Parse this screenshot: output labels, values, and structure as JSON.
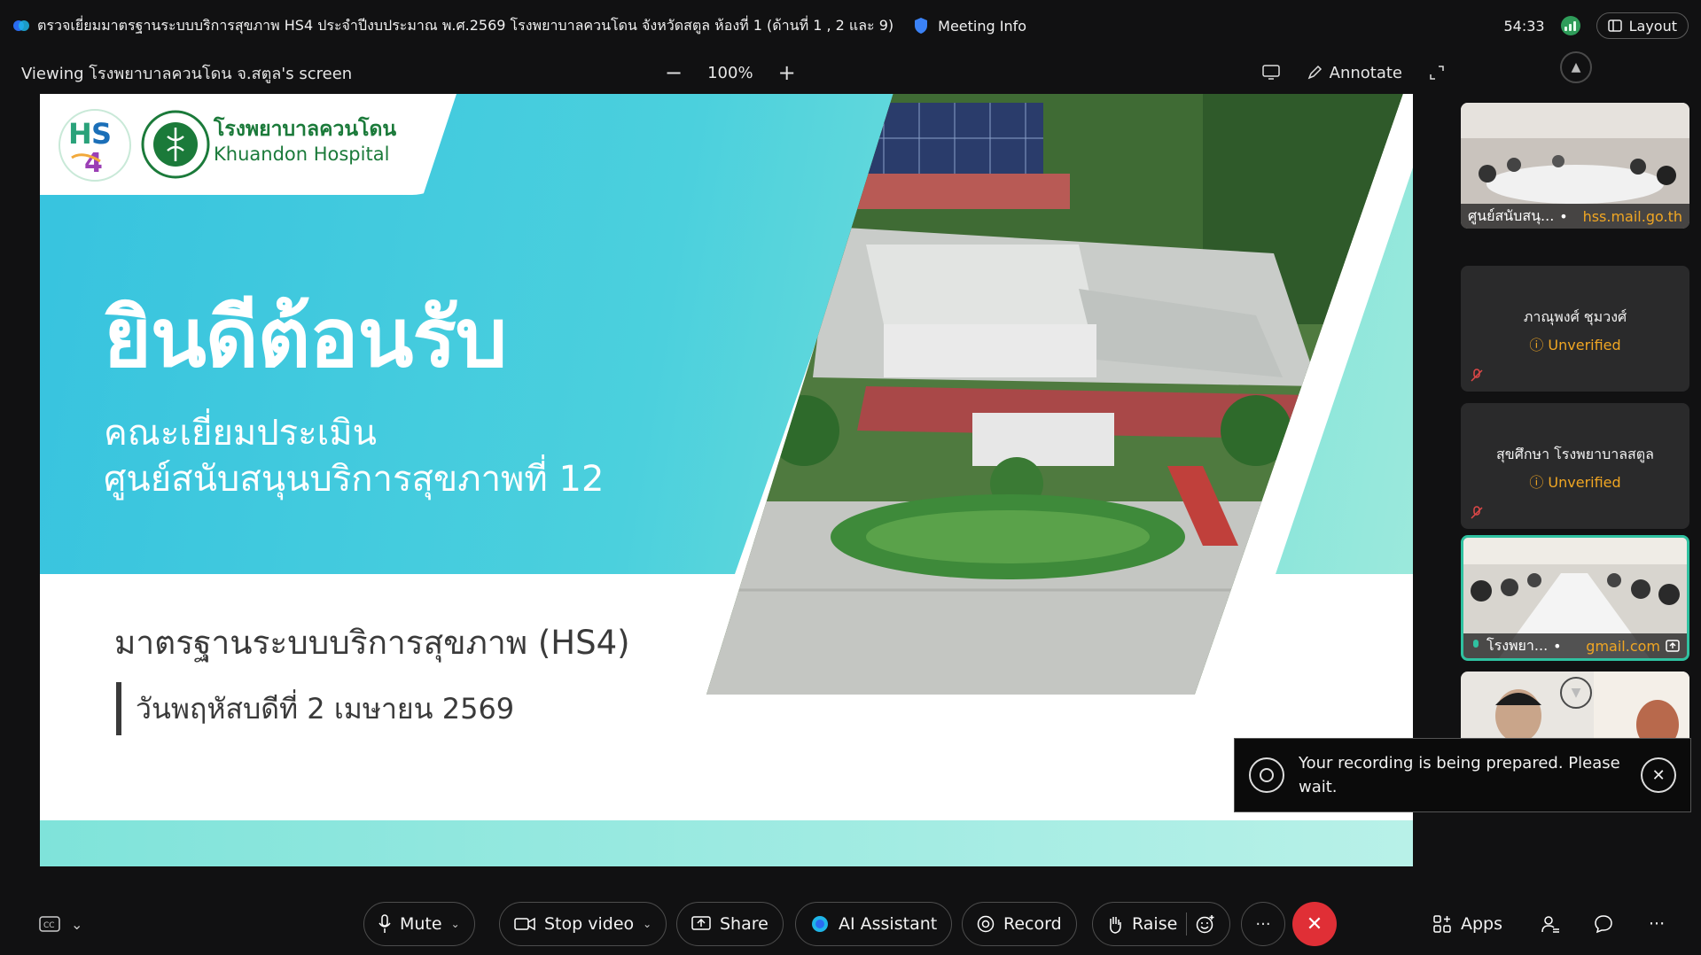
{
  "titlebar": {
    "meeting_title": "ตรวจเยี่ยมมาตรฐานระบบบริการสุขภาพ HS4 ประจำปีงบประมาณ พ.ศ.2569 โรงพยาบาลควนโดน จังหวัดสตูล  ห้องที่ 1 (ด้านที่ 1 , 2 และ 9)",
    "meeting_info": "Meeting Info",
    "timer": "54:33",
    "layout_label": "Layout"
  },
  "viewbar": {
    "viewing": "Viewing โรงพยาบาลควนโดน จ.สตูล's screen",
    "zoom": "100%",
    "annotate": "Annotate"
  },
  "slide": {
    "hospital_th": "โรงพยาบาลควนโดน",
    "hospital_en": "Khuandon Hospital",
    "welcome": "ยินดีต้อนรับ",
    "subtitle1": "คณะเยี่ยมประเมิน",
    "subtitle2": "ศูนย์สนับสนุนบริการสุขภาพที่ 12",
    "standard": "มาตรฐานระบบบริการสุขภาพ (HS4)",
    "date": "วันพฤหัสบดีที่ 2 เมษายน 2569"
  },
  "participants": [
    {
      "label": "ศูนย์สนับสนุ...",
      "domain": "hss.mail.go.th"
    },
    {
      "name": "ภาณุพงศ์ ชุมวงศ์",
      "status": "Unverified"
    },
    {
      "name": "สุขศึกษา โรงพยาบาลสตูล",
      "status": "Unverified"
    },
    {
      "label": "โรงพยา...",
      "domain": "gmail.com"
    }
  ],
  "toast": {
    "message": "Your recording is being prepared. Please wait."
  },
  "controls": {
    "mute": "Mute",
    "stop_video": "Stop video",
    "share": "Share",
    "ai_assistant": "AI Assistant",
    "record": "Record",
    "raise": "Raise",
    "apps": "Apps"
  },
  "colors": {
    "accent_teal": "#2fc1a0",
    "end_red": "#e02f36",
    "unverified": "#f0a623"
  }
}
